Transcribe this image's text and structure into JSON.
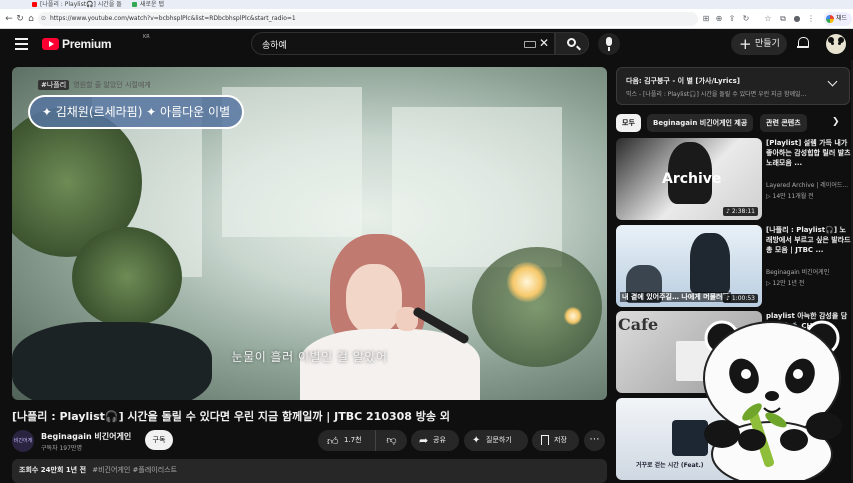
{
  "browser": {
    "tabs": [
      {
        "title": "[나플리 : Playlist🎧] 시간을 돌",
        "color": "#ff0000"
      },
      {
        "title": "새로운 탭",
        "color": "#34a853"
      }
    ],
    "url": "https://www.youtube.com/watch?v=bcbhsplPlc&list=RDbcbhsplPlc&start_radio=1",
    "profile_label": "채드"
  },
  "header": {
    "logo_text": "Premium",
    "region": "KR",
    "search_value": "송하예",
    "create_label": "만들기"
  },
  "player": {
    "tag_label": "#나플리",
    "tag_text": "영원할 줄 알았던 시절에게",
    "overlay_title": "✦ 김채원(르세라핌) ✦ 아름다운 이별",
    "subtitle": "눈물이 흘러 이별인 걸 알았어"
  },
  "video": {
    "title": "[나플리 : Playlist🎧] 시간을 돌릴 수 있다면 우린 지금 함께일까 | JTBC 210308 방송 외",
    "channel_name": "Beginagain 비긴어게인",
    "channel_avatar_text": "비긴어게인",
    "subscribers": "구독자 197만명",
    "subscribe_label": "구독",
    "like_count": "1.7천",
    "share_label": "공유",
    "ask_label": "질문하기",
    "save_label": "저장",
    "description_meta": "조회수 24만회  1년 전",
    "description_tags": "#비긴어게인 #플레이리스트"
  },
  "sidebar": {
    "next_title": "다음: 김구붕구 - 이 별 [가사/Lyrics]",
    "next_sub": "믹스 - [나플리 : Playlist🎧] 시간을 돌릴 수 있다면 우린 지금 함께일...",
    "chips": [
      "모두",
      "Beginagain 비긴어게인 제공",
      "관련 콘텐츠"
    ],
    "recommendations": [
      {
        "title": "[Playlist] 설렘 가득 내가 좋아하는 감성힙합 릴러 발츠 노래모음 ...",
        "channel": "Layered Archive | 레이어드...",
        "meta": "▷ 14만  11개월 전",
        "duration": "♪ 2:38:11",
        "thumb_text": "Archive"
      },
      {
        "title": "[나플리 : Playlist🎧] 노래방에서 부르고 싶은 발라드 총 모음 | JTBC ...",
        "channel": "Beginagain 비긴어게인",
        "meta": "▷ 12만  1년 전",
        "duration": "♪ 1:00:53",
        "thumb_text": "내 곁에 있어주길… 나에게 머물러줘"
      },
      {
        "title": "playlist 아늑한 감성을 담은 음악 🍵 CHILL",
        "channel": "",
        "meta": "",
        "duration": "",
        "thumb_text": "Cafe"
      },
      {
        "title": "",
        "channel": "",
        "meta": "",
        "duration": "",
        "thumb_text": "거꾸로 걷는 시간 (Feat.)"
      }
    ]
  },
  "colors": {
    "background": "#0f0f0f",
    "accent": "#ff0033",
    "chip_active": "#f1f1f1"
  }
}
